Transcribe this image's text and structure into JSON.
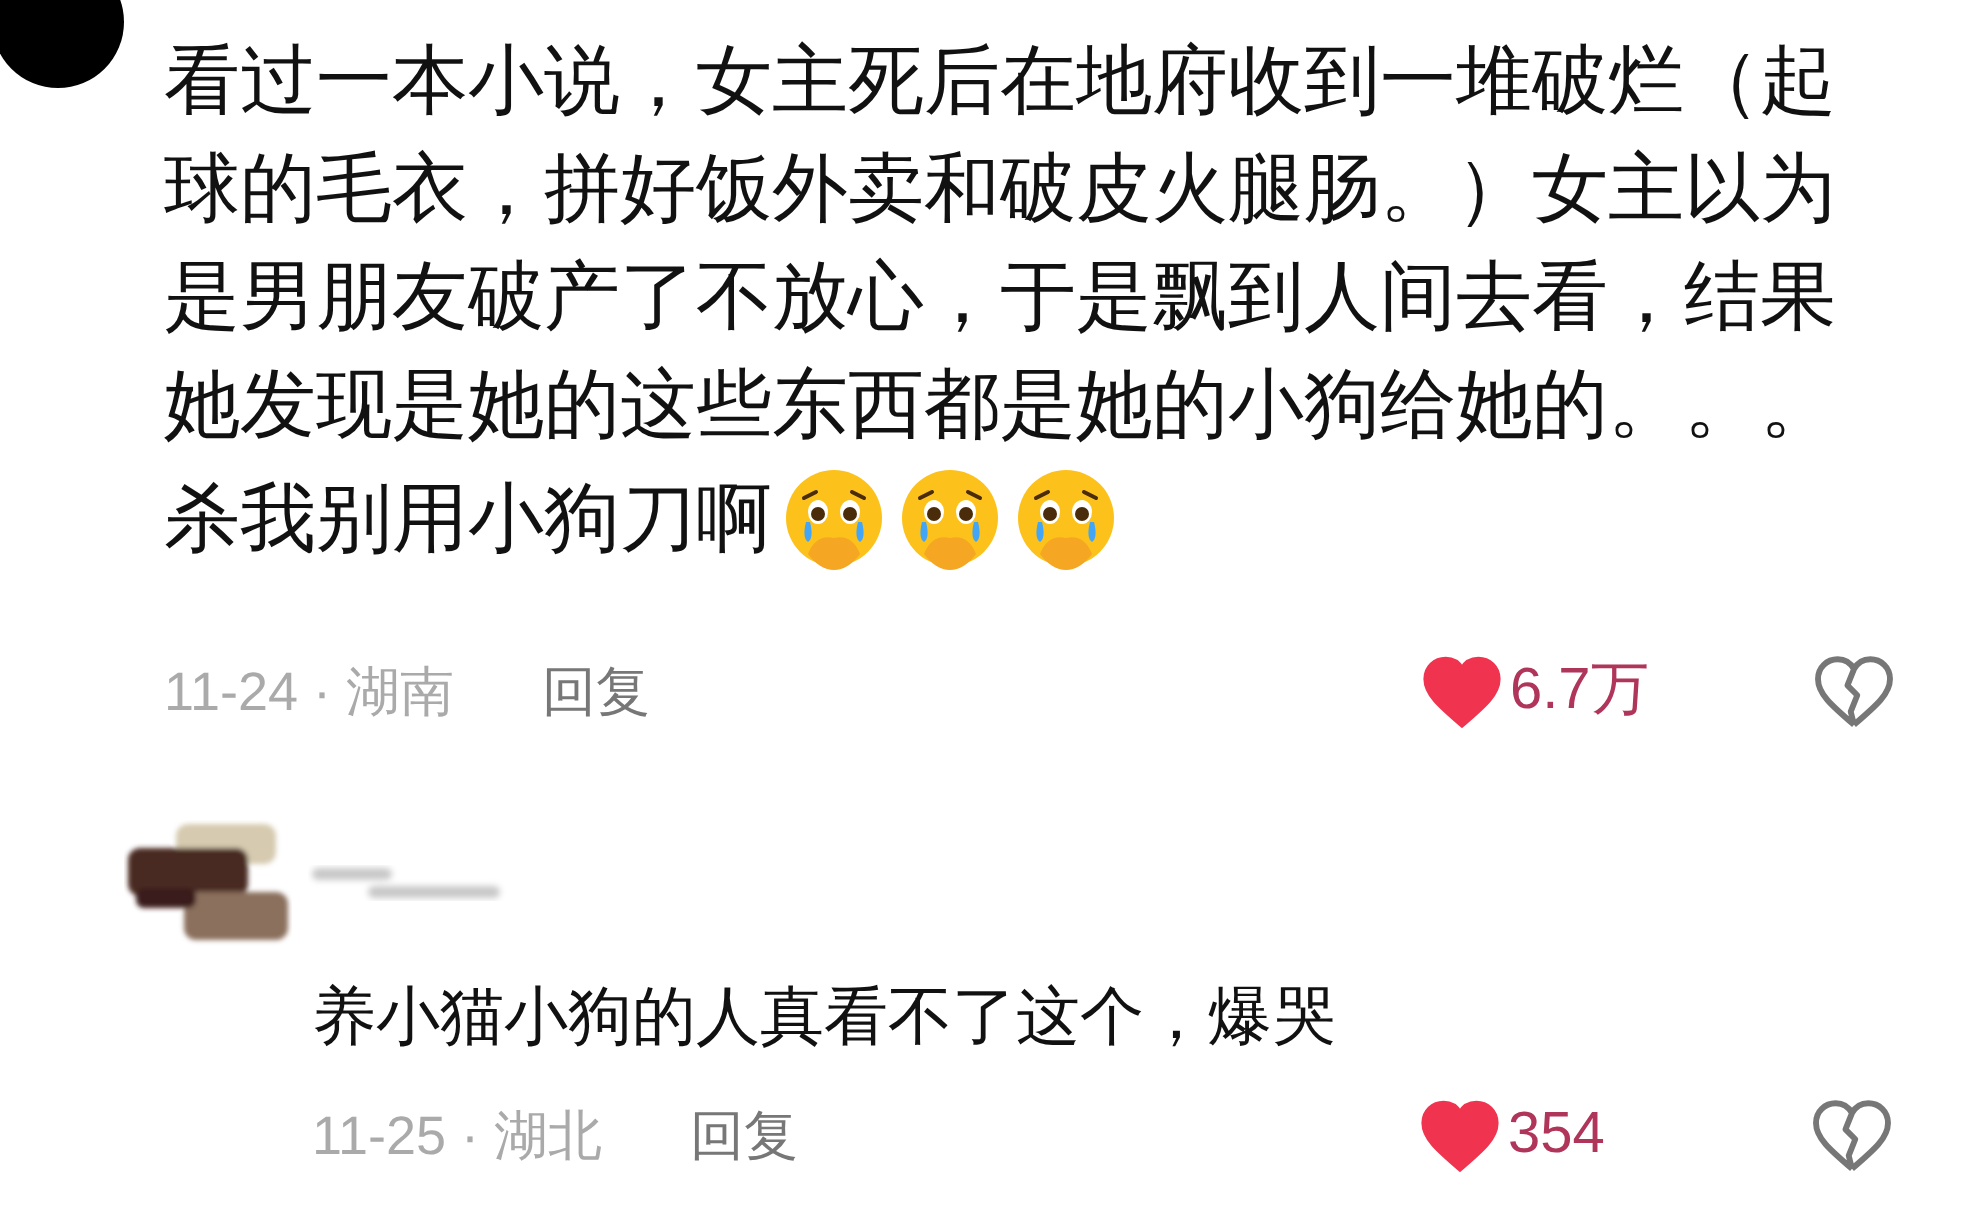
{
  "comments": [
    {
      "avatar": {
        "kind": "dark"
      },
      "paragraphs": [
        "看过一本小说，女主死后在地府收到一堆破烂（起球的毛衣，拼好饭外卖和破皮火腿肠。）女主以为是男朋友破产了不放心，于是飘到人间去看，结果她发现是她的这些东西都是她的小狗给她的。。。",
        "杀我别用小狗刀啊"
      ],
      "emojis": [
        {
          "kind": "crying"
        },
        {
          "kind": "crying"
        },
        {
          "kind": "crying"
        }
      ],
      "meta": "11-24 · 湖南",
      "reply": "回复",
      "likes": "6.7万",
      "liked": true
    },
    {
      "avatar": {
        "kind": "blurred"
      },
      "username_blurred": true,
      "paragraphs": [
        "养小猫小狗的人真看不了这个，爆哭"
      ],
      "meta": "11-25 · 湖北",
      "reply": "回复",
      "likes": "354",
      "liked": true
    }
  ]
}
